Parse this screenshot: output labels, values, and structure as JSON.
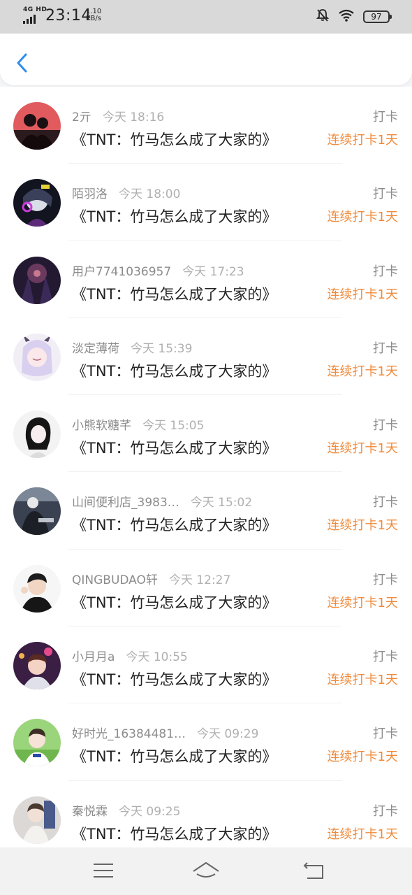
{
  "status_bar": {
    "network": "4G HD",
    "time": "23:14",
    "speed_value": "1.10",
    "speed_unit": "KB/s",
    "battery": "97"
  },
  "header": {
    "back_icon": "chevron-left-icon"
  },
  "colors": {
    "accent": "#f08a3a",
    "back_blue": "#2b8ef0"
  },
  "entries": [
    {
      "username": "2亓",
      "time": "今天 18:16",
      "book": "《TNT：竹马怎么成了大家的》",
      "label": "打卡",
      "streak": "连续打卡1天"
    },
    {
      "username": "陌羽洛",
      "time": "今天 18:00",
      "book": "《TNT：竹马怎么成了大家的》",
      "label": "打卡",
      "streak": "连续打卡1天"
    },
    {
      "username": "用户7741036957",
      "time": "今天 17:23",
      "book": "《TNT：竹马怎么成了大家的》",
      "label": "打卡",
      "streak": "连续打卡1天"
    },
    {
      "username": "淡定薄荷",
      "time": "今天 15:39",
      "book": "《TNT：竹马怎么成了大家的》",
      "label": "打卡",
      "streak": "连续打卡1天"
    },
    {
      "username": "小熊软糖芊",
      "time": "今天 15:05",
      "book": "《TNT：竹马怎么成了大家的》",
      "label": "打卡",
      "streak": "连续打卡1天"
    },
    {
      "username": "山间便利店_3983…",
      "time": "今天 15:02",
      "book": "《TNT：竹马怎么成了大家的》",
      "label": "打卡",
      "streak": "连续打卡1天"
    },
    {
      "username": "QINGBUDAO轩",
      "time": "今天 12:27",
      "book": "《TNT：竹马怎么成了大家的》",
      "label": "打卡",
      "streak": "连续打卡1天"
    },
    {
      "username": "小月月a",
      "time": "今天 10:55",
      "book": "《TNT：竹马怎么成了大家的》",
      "label": "打卡",
      "streak": "连续打卡1天"
    },
    {
      "username": "好时光_16384481…",
      "time": "今天 09:29",
      "book": "《TNT：竹马怎么成了大家的》",
      "label": "打卡",
      "streak": "连续打卡1天"
    },
    {
      "username": "秦悦霖",
      "time": "今天 09:25",
      "book": "《TNT：竹马怎么成了大家的》",
      "label": "打卡",
      "streak": "连续打卡1天"
    }
  ],
  "nav_bar": {
    "menu_icon": "menu-icon",
    "home_icon": "home-icon",
    "back_icon": "back-icon"
  }
}
